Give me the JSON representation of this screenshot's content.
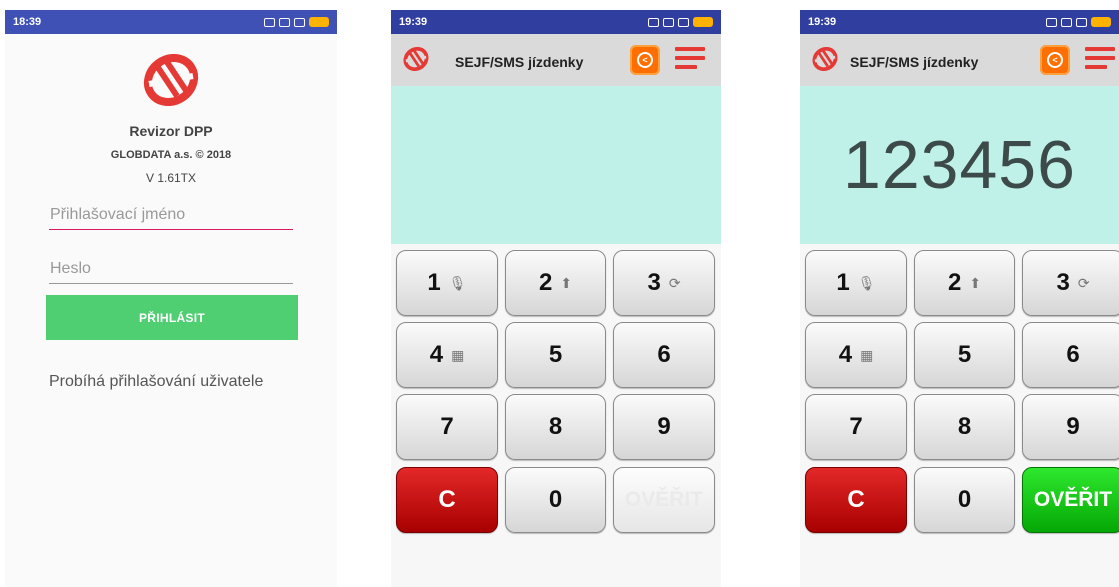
{
  "login_screen": {
    "status_time": "18:39",
    "app_name": "Revizor DPP",
    "company": "GLOBDATA a.s. © 2018",
    "version": "V 1.61TX",
    "username_placeholder": "Přihlašovací jméno",
    "password_placeholder": "Heslo",
    "login_button": "PŘIHLÁSIT",
    "status_message": "Probíhá přihlašování uživatele"
  },
  "keypad_screen_empty": {
    "status_time": "19:39",
    "title": "SEJF/SMS jízdenky",
    "display_value": "",
    "keys": [
      {
        "label": "1",
        "icon": "mic-icon",
        "glyph": "🎙"
      },
      {
        "label": "2",
        "icon": "upload-icon",
        "glyph": "⬆"
      },
      {
        "label": "3",
        "icon": "sync-icon",
        "glyph": "⟳"
      },
      {
        "label": "4",
        "icon": "qr-code-icon",
        "glyph": "▦"
      },
      {
        "label": "5"
      },
      {
        "label": "6"
      },
      {
        "label": "7"
      },
      {
        "label": "8"
      },
      {
        "label": "9"
      }
    ],
    "clear_label": "C",
    "zero_label": "0",
    "verify_label": "OVĚŘIT"
  },
  "keypad_screen_filled": {
    "status_time": "19:39",
    "title": "SEJF/SMS jízdenky",
    "display_value": "123456",
    "keys": [
      {
        "label": "1",
        "icon": "mic-icon",
        "glyph": "🎙"
      },
      {
        "label": "2",
        "icon": "upload-icon",
        "glyph": "⬆"
      },
      {
        "label": "3",
        "icon": "sync-icon",
        "glyph": "⟳"
      },
      {
        "label": "4",
        "icon": "qr-code-icon",
        "glyph": "▦"
      },
      {
        "label": "5"
      },
      {
        "label": "6"
      },
      {
        "label": "7"
      },
      {
        "label": "8"
      },
      {
        "label": "9"
      }
    ],
    "clear_label": "C",
    "zero_label": "0",
    "verify_label": "OVĚŘIT"
  },
  "colors": {
    "status_bar": "#3f51b5",
    "brand_red": "#e53935",
    "login_button": "#4fce72",
    "display_bg": "#bff1e9",
    "clear_key": "#c40000",
    "verify_active": "#18c418"
  }
}
